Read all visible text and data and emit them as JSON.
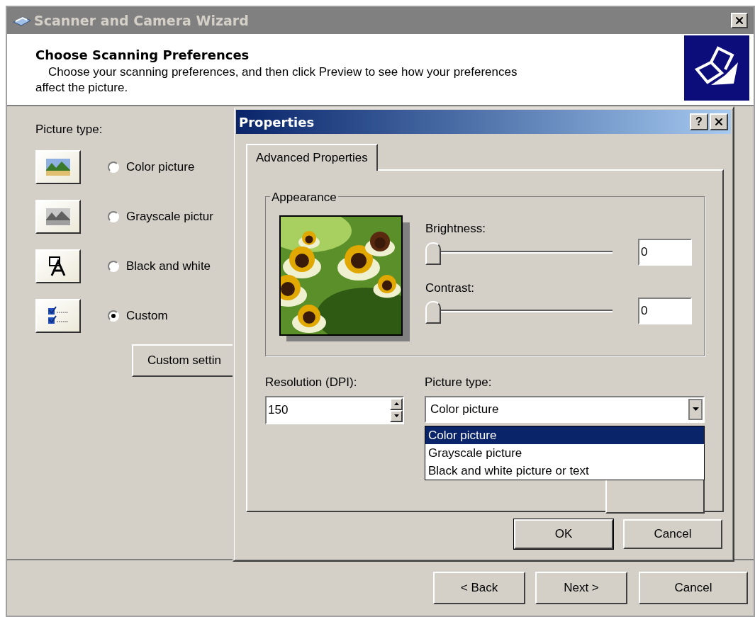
{
  "wizard": {
    "title": "Scanner and Camera Wizard",
    "heading": "Choose Scanning Preferences",
    "description": "Choose your scanning preferences, and then click Preview to see how your preferences affect the picture.",
    "picture_type_label": "Picture type:",
    "options": [
      {
        "kind": "color",
        "label": "Color picture",
        "selected": false
      },
      {
        "kind": "grayscale",
        "label": "Grayscale pictur",
        "selected": false
      },
      {
        "kind": "text",
        "label": "Black and white",
        "selected": false
      },
      {
        "kind": "custom",
        "label": "Custom",
        "selected": true
      }
    ],
    "custom_settings_button": "Custom settin",
    "buttons": [
      "< Back",
      "Next >",
      "Cancel"
    ]
  },
  "dialog": {
    "title": "Properties",
    "help_button": "?",
    "tabs": [
      {
        "label": "Advanced Properties",
        "selected": true
      }
    ],
    "appearance": {
      "label": "Appearance",
      "sliders": [
        {
          "label": "Brightness:",
          "level": 0,
          "value": "0"
        },
        {
          "label": "Contrast:",
          "level": 0,
          "value": "0"
        }
      ]
    },
    "resolution": {
      "label": "Resolution (DPI):",
      "value": "150"
    },
    "picture_type": {
      "label": "Picture type:",
      "value": "Color picture",
      "expanded": true,
      "options": [
        {
          "label": "Color picture",
          "selected": true
        },
        {
          "label": "Grayscale picture",
          "selected": false
        },
        {
          "label": "Black and white picture or text",
          "selected": false
        }
      ]
    },
    "buttons": [
      "OK",
      "Cancel"
    ]
  }
}
